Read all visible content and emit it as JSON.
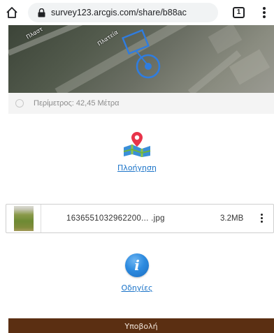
{
  "browser": {
    "url": "survey123.arcgis.com/share/b88ac",
    "tab_count": "1"
  },
  "map": {
    "street_label_1": "Πλαστ",
    "street_label_2": "Πλατεία"
  },
  "perimeter": {
    "text": "Περίμετρος: 42,45 Μέτρα"
  },
  "navigation": {
    "label": "Πλοήγηση"
  },
  "attachment": {
    "file_name": "1636551032962200... .jpg",
    "file_size": "3.2MB"
  },
  "instructions": {
    "label": "Οδηγίες"
  },
  "submit": {
    "label": "Υποβολή"
  },
  "colors": {
    "submit_bg": "#5b2f12",
    "link": "#1a73c8",
    "geometry_stroke": "#2f7de0"
  },
  "icons": [
    "home-icon",
    "lock-icon",
    "tab-count-icon",
    "menu-dots-icon",
    "info-circle-icon",
    "navigation-map-icon",
    "info-icon",
    "file-menu-icon"
  ]
}
